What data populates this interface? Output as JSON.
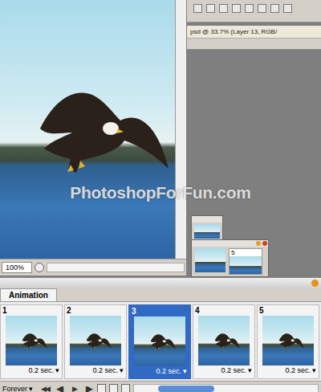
{
  "document": {
    "zoom": "100%"
  },
  "second_window": {
    "title": "psd @ 33.7% (Layer 13, RGB/"
  },
  "mini_window": {
    "label": "5"
  },
  "watermark": "PhotoshopForFun.com",
  "animation": {
    "tab": "Animation",
    "frames": [
      {
        "number": "1",
        "delay": "0.2 sec.",
        "menu": "▾",
        "selected": false
      },
      {
        "number": "2",
        "delay": "0.2 sec.",
        "menu": "▾",
        "selected": false
      },
      {
        "number": "3",
        "delay": "0.2 sec.",
        "menu": "▾",
        "selected": true
      },
      {
        "number": "4",
        "delay": "0.2 sec.",
        "menu": "▾",
        "selected": false
      },
      {
        "number": "5",
        "delay": "0.2 sec.",
        "menu": "▾",
        "selected": false
      }
    ],
    "loop": "Forever",
    "loop_menu": "▾",
    "controls": [
      "◀◀",
      "◀▮",
      "▶",
      "▮▶"
    ]
  }
}
